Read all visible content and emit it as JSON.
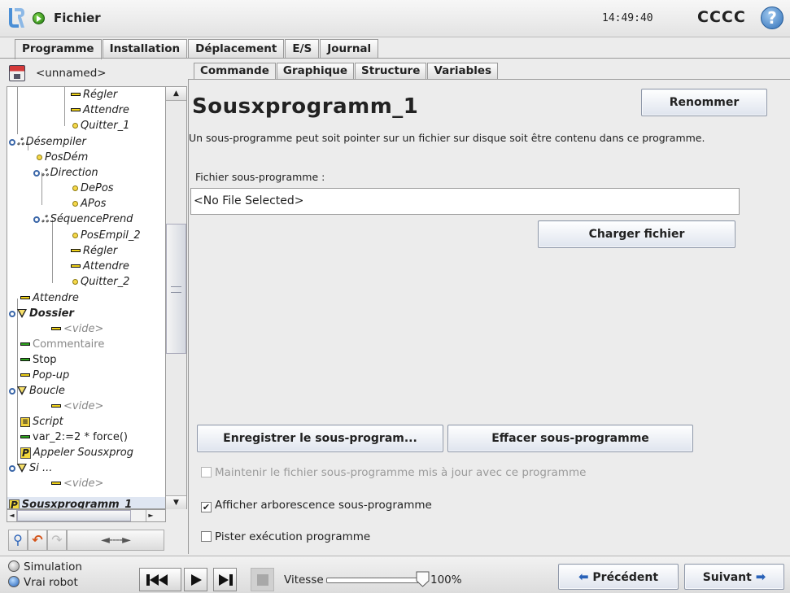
{
  "header": {
    "file_menu": "Fichier",
    "clock": "14:49:40",
    "robot_name": "CCCC",
    "help_glyph": "?"
  },
  "main_tabs": [
    "Programme",
    "Installation",
    "Déplacement",
    "E/S",
    "Journal"
  ],
  "program": {
    "name": "<unnamed>"
  },
  "tree": [
    {
      "label": "Régler"
    },
    {
      "label": "Attendre"
    },
    {
      "label": "Quitter_1"
    },
    {
      "label": "Désempiler"
    },
    {
      "label": "PosDém"
    },
    {
      "label": "Direction"
    },
    {
      "label": "DePos"
    },
    {
      "label": "APos"
    },
    {
      "label": "SéquencePrend"
    },
    {
      "label": "PosEmpil_2"
    },
    {
      "label": "Régler"
    },
    {
      "label": "Attendre"
    },
    {
      "label": "Quitter_2"
    },
    {
      "label": "Attendre"
    },
    {
      "label": "Dossier"
    },
    {
      "label": "<vide>"
    },
    {
      "label": "Commentaire"
    },
    {
      "label": "Stop"
    },
    {
      "label": "Pop-up"
    },
    {
      "label": "Boucle"
    },
    {
      "label": "<vide>"
    },
    {
      "label": "Script"
    },
    {
      "label": "var_2:=2 * force()"
    },
    {
      "label": "Appeler Sousxprog"
    },
    {
      "label": "Si ..."
    },
    {
      "label": "<vide>"
    },
    {
      "label": "Sousxprogramm_1"
    }
  ],
  "tree_tools": {
    "range_glyph": "◄----►"
  },
  "sub_tabs": [
    "Commande",
    "Graphique",
    "Structure",
    "Variables"
  ],
  "command": {
    "title": "Sousxprogramm_1",
    "rename_label": "Renommer",
    "description": "Un sous-programme peut soit pointer sur un fichier sur disque soit être contenu dans ce programme.",
    "file_label": "Fichier sous-programme :",
    "file_value": "<No File Selected>",
    "load_label": "Charger fichier",
    "save_sub_label": "Enregistrer le sous-program...",
    "clear_sub_label": "Effacer sous-programme",
    "keep_updated_label": "Maintenir le fichier sous-programme mis à jour avec ce programme",
    "keep_updated_checked": false,
    "show_tree_label": "Afficher arborescence sous-programme",
    "show_tree_checked": true,
    "track_exec_label": "Pister exécution programme",
    "track_exec_checked": false
  },
  "footer": {
    "simulation_label": "Simulation",
    "real_robot_label": "Vrai robot",
    "speed_label": "Vitesse",
    "speed_value": "100%",
    "speed_fraction": 1.0,
    "prev_label": "Précédent",
    "next_label": "Suivant",
    "mode": "Vrai robot"
  },
  "colors": {
    "accent_blue": "#2a62b8",
    "run_green": "#2ea31e",
    "logo_blue": "#4b8fd6"
  }
}
